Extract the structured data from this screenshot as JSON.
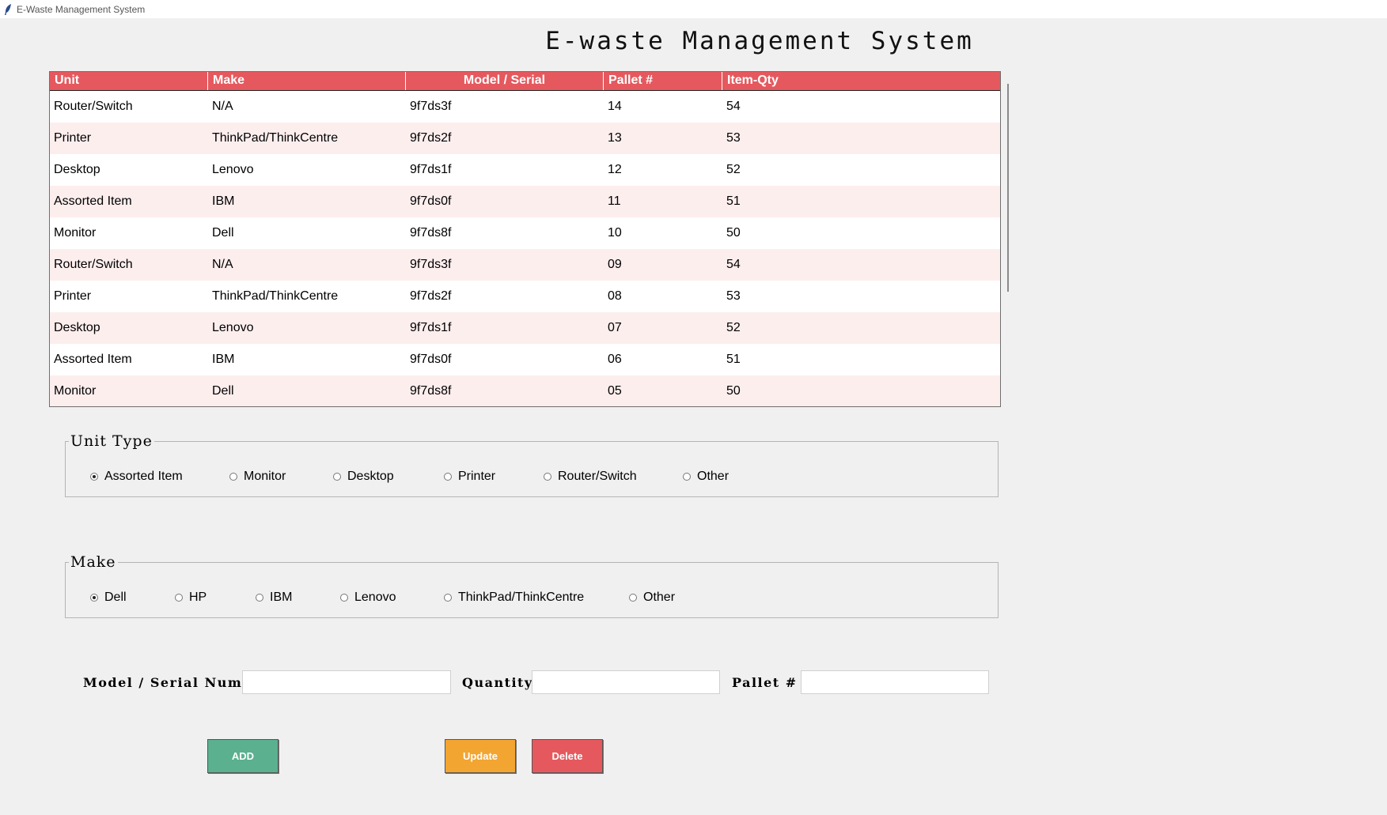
{
  "window": {
    "title": "E-Waste Management System"
  },
  "heading": "E-waste Management System",
  "table": {
    "columns": [
      "Unit",
      "Make",
      "Model / Serial",
      "Pallet #",
      "Item-Qty"
    ],
    "rows": [
      [
        "Router/Switch",
        "N/A",
        "9f7ds3f",
        "14",
        "54"
      ],
      [
        "Printer",
        "ThinkPad/ThinkCentre",
        "9f7ds2f",
        "13",
        "53"
      ],
      [
        "Desktop",
        "Lenovo",
        "9f7ds1f",
        "12",
        "52"
      ],
      [
        "Assorted Item",
        "IBM",
        "9f7ds0f",
        "11",
        "51"
      ],
      [
        "Monitor",
        "Dell",
        "9f7ds8f",
        "10",
        "50"
      ],
      [
        "Router/Switch",
        "N/A",
        "9f7ds3f",
        "09",
        "54"
      ],
      [
        "Printer",
        "ThinkPad/ThinkCentre",
        "9f7ds2f",
        "08",
        "53"
      ],
      [
        "Desktop",
        "Lenovo",
        "9f7ds1f",
        "07",
        "52"
      ],
      [
        "Assorted Item",
        "IBM",
        "9f7ds0f",
        "06",
        "51"
      ],
      [
        "Monitor",
        "Dell",
        "9f7ds8f",
        "05",
        "50"
      ]
    ]
  },
  "unit_type": {
    "legend": "Unit Type",
    "options": [
      "Assorted Item",
      "Monitor",
      "Desktop",
      "Printer",
      "Router/Switch",
      "Other"
    ],
    "selected": "Assorted Item"
  },
  "make": {
    "legend": "Make",
    "options": [
      "Dell",
      "HP",
      "IBM",
      "Lenovo",
      "ThinkPad/ThinkCentre",
      "Other"
    ],
    "selected": "Dell"
  },
  "form": {
    "model_label": "Model / Serial Number",
    "model_value": "",
    "quantity_label": "Quantity",
    "quantity_value": "",
    "pallet_label": "Pallet #",
    "pallet_value": ""
  },
  "buttons": {
    "add": "ADD",
    "update": "Update",
    "delete": "Delete"
  },
  "colors": {
    "header_bg": "#e5595e",
    "row_alt": "#fdeeee",
    "add": "#5bb08f",
    "update": "#f2a531",
    "delete": "#e5595e"
  }
}
